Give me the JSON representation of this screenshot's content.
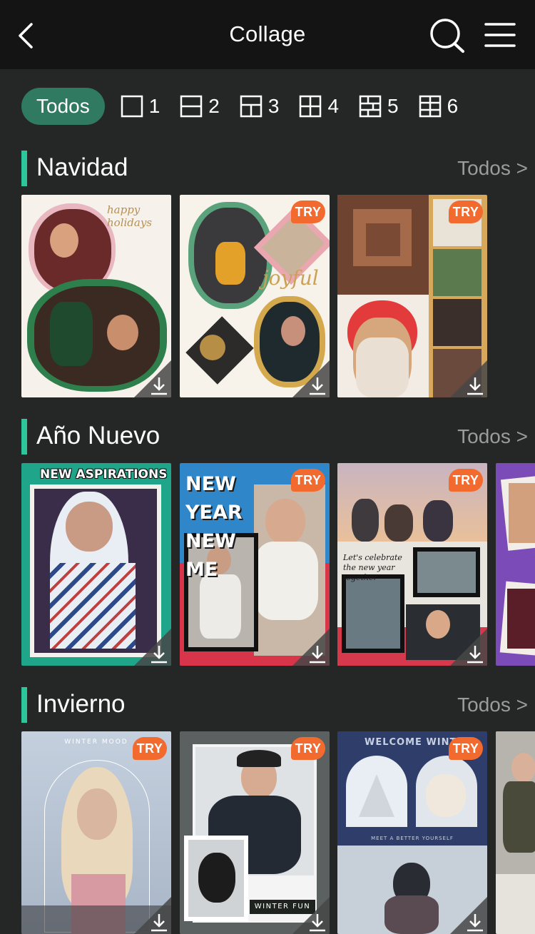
{
  "header": {
    "title": "Collage",
    "icons": [
      "back-arrow-icon",
      "search-icon",
      "menu-icon"
    ]
  },
  "filters": {
    "active_label": "Todos",
    "layouts": [
      {
        "label": "1",
        "icon": "layout-1-icon"
      },
      {
        "label": "2",
        "icon": "layout-2-icon"
      },
      {
        "label": "3",
        "icon": "layout-3-icon"
      },
      {
        "label": "4",
        "icon": "layout-4-icon"
      },
      {
        "label": "5",
        "icon": "layout-5-icon"
      },
      {
        "label": "6",
        "icon": "layout-6-icon"
      }
    ]
  },
  "badge_try": "TRY",
  "sections": [
    {
      "title": "Navidad",
      "see_all": "Todos >",
      "cards": [
        {
          "text": "happy holidays",
          "try": false
        },
        {
          "text": "joyful",
          "try": true
        },
        {
          "text": "",
          "try": true
        }
      ]
    },
    {
      "title": "Año Nuevo",
      "see_all": "Todos >",
      "cards": [
        {
          "text": "NEW ASPIRATIONS",
          "try": false
        },
        {
          "text": "NEW YEAR NEW ME",
          "try": true
        },
        {
          "text": "Let's celebrate the new year together",
          "try": true
        },
        {
          "text": "",
          "try": false
        }
      ]
    },
    {
      "title": "Invierno",
      "see_all": "Todos >",
      "cards": [
        {
          "text": "WINTER MOOD",
          "try": true
        },
        {
          "text": "WINTER FUN",
          "try": true
        },
        {
          "text": "WELCOME WINTER",
          "sub": "MEET A BETTER YOURSELF",
          "try": true
        },
        {
          "text": "",
          "try": false
        }
      ]
    }
  ],
  "colors": {
    "background": "#252726",
    "header": "#141414",
    "accent": "#2fc59a",
    "pill": "#2f7a60",
    "try_badge": "#f26a2e"
  }
}
